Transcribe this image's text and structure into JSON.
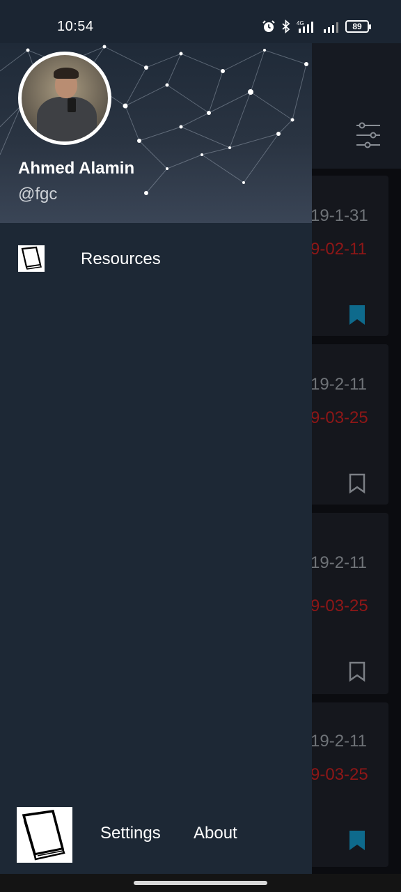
{
  "status_bar": {
    "time": "10:54",
    "battery": "89",
    "network": "4G",
    "icons": [
      "alarm-icon",
      "bluetooth-icon",
      "signal-icon",
      "signal-icon",
      "battery-icon"
    ]
  },
  "drawer": {
    "user": {
      "name": "Ahmed Alamin",
      "handle": "@fgc"
    },
    "menu": [
      {
        "label": "Resources",
        "icon": "book-icon"
      }
    ],
    "footer": {
      "icon": "book-icon",
      "settings_label": "Settings",
      "about_label": "About"
    }
  },
  "background_list": {
    "cards": [
      {
        "date": "19-1-31",
        "due": "9-02-11",
        "bookmarked": true
      },
      {
        "date": "19-2-11",
        "due": "9-03-25",
        "bookmarked": false
      },
      {
        "date": "19-2-11",
        "due": "9-03-25",
        "bookmarked": false
      },
      {
        "date": "19-2-11",
        "due": "9-03-25",
        "bookmarked": true
      }
    ]
  },
  "colors": {
    "drawer_bg": "#1d2835",
    "due_red": "#8e1717",
    "bookmark_teal": "#0e6a8c"
  }
}
